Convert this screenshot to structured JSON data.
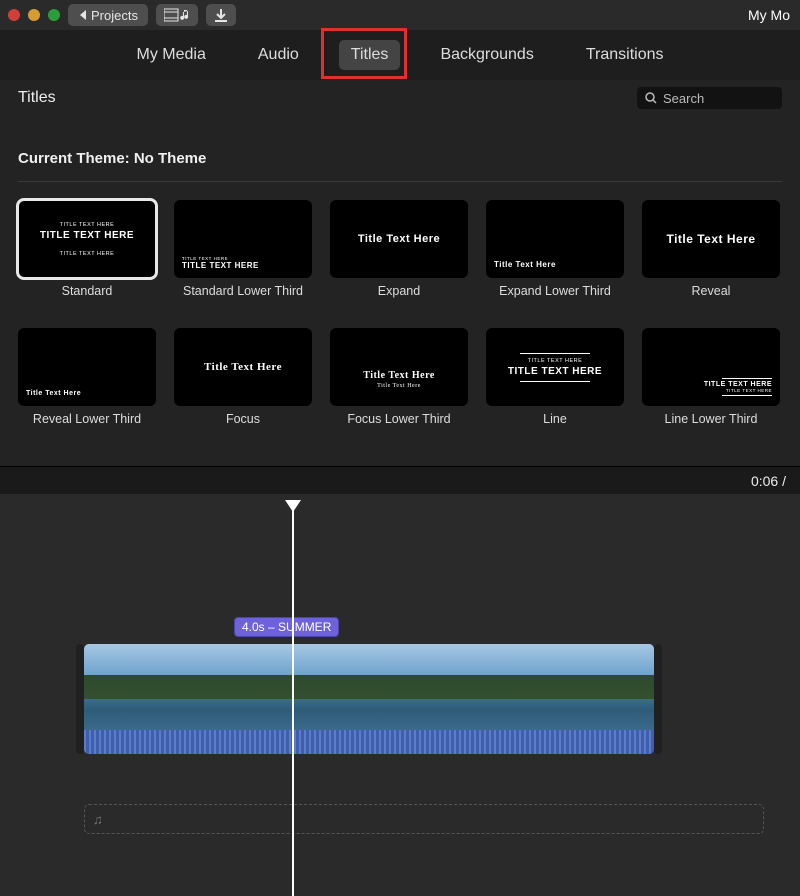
{
  "toolbar": {
    "projects_label": "Projects",
    "doc_title": "My Mo"
  },
  "tabs": [
    {
      "id": "my-media",
      "label": "My Media",
      "active": false
    },
    {
      "id": "audio",
      "label": "Audio",
      "active": false
    },
    {
      "id": "titles",
      "label": "Titles",
      "active": true
    },
    {
      "id": "backgrounds",
      "label": "Backgrounds",
      "active": false
    },
    {
      "id": "transitions",
      "label": "Transitions",
      "active": false
    }
  ],
  "browser": {
    "section_title": "Titles",
    "search_placeholder": "Search",
    "theme_label": "Current Theme: No Theme"
  },
  "titles": [
    {
      "id": "standard",
      "label": "Standard",
      "selected": true,
      "layout": "center",
      "overline": "TITLE TEXT HERE",
      "main": "TITLE TEXT HERE",
      "sub": "TITLE TEXT HERE"
    },
    {
      "id": "standard-lower-3rd",
      "label": "Standard Lower Third",
      "selected": false,
      "layout": "lower-third",
      "overline": "TITLE TEXT HERE",
      "main": "TITLE TEXT HERE",
      "sub": ""
    },
    {
      "id": "expand",
      "label": "Expand",
      "selected": false,
      "layout": "center",
      "overline": "",
      "main": "Title Text Here",
      "sub": ""
    },
    {
      "id": "expand-lower-3rd",
      "label": "Expand Lower Third",
      "selected": false,
      "layout": "lower-third",
      "overline": "",
      "main": "Title Text Here",
      "sub": ""
    },
    {
      "id": "reveal",
      "label": "Reveal",
      "selected": false,
      "layout": "center",
      "overline": "",
      "main": "Title Text Here",
      "sub": ""
    },
    {
      "id": "reveal-lower-3rd",
      "label": "Reveal Lower Third",
      "selected": false,
      "layout": "lower-third",
      "overline": "",
      "main": "Title Text Here",
      "sub": ""
    },
    {
      "id": "focus",
      "label": "Focus",
      "selected": false,
      "layout": "center",
      "overline": "",
      "main": "Title Text Here",
      "sub": ""
    },
    {
      "id": "focus-lower-3rd",
      "label": "Focus Lower Third",
      "selected": false,
      "layout": "center-low",
      "overline": "",
      "main": "Title Text Here",
      "sub": "Title Text Here"
    },
    {
      "id": "line",
      "label": "Line",
      "selected": false,
      "layout": "line",
      "overline": "TITLE TEXT HERE",
      "main": "TITLE TEXT HERE",
      "sub": ""
    },
    {
      "id": "line-lower-3rd",
      "label": "Line Lower Third",
      "selected": false,
      "layout": "line-lower",
      "overline": "TITLE TEXT HERE",
      "main": "TITLE TEXT HERE",
      "sub": ""
    }
  ],
  "timeline": {
    "time_display": "0:06 /",
    "title_clip_label": "4.0s – SUMMER",
    "audio_icon": "♫"
  }
}
